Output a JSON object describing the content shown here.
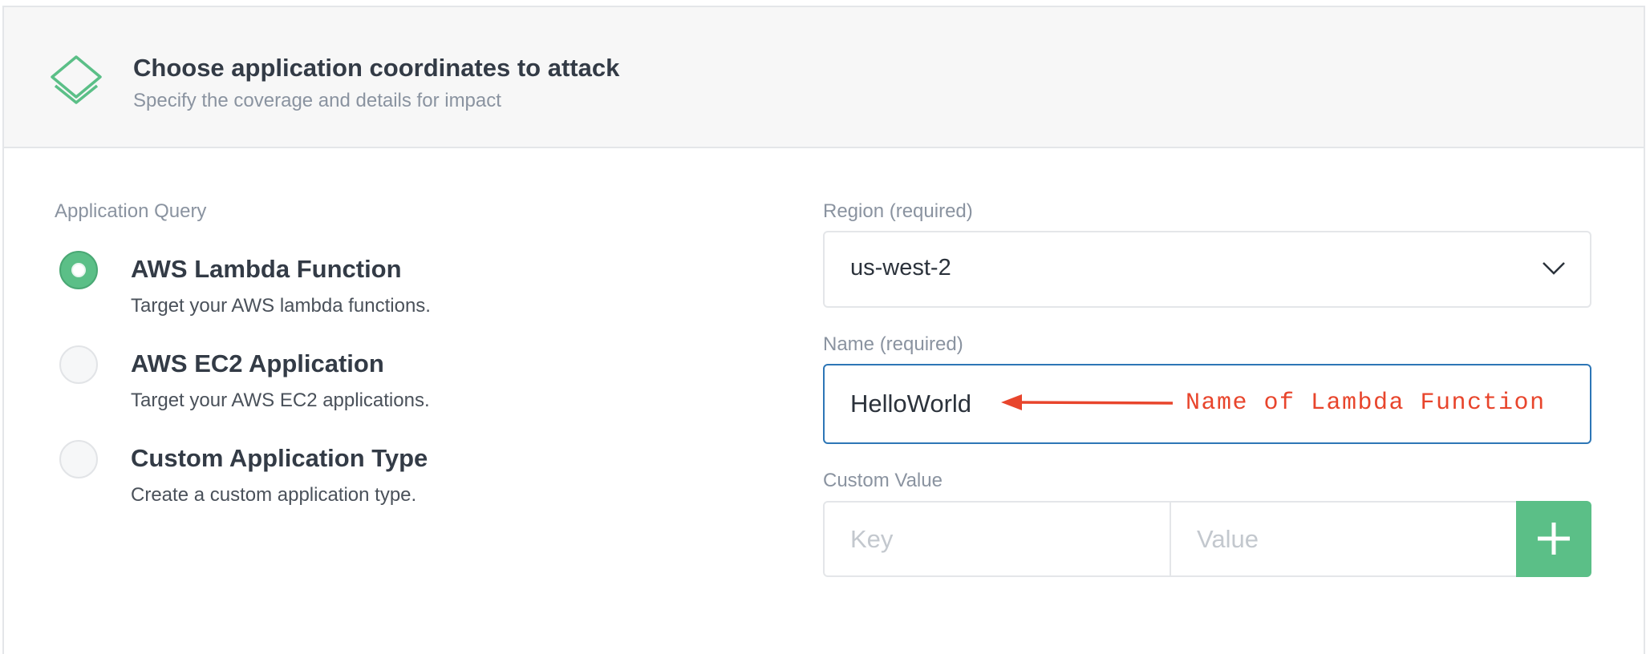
{
  "header": {
    "title": "Choose application coordinates to attack",
    "subtitle": "Specify the coverage and details for impact",
    "icon": "layers-icon",
    "accent_color": "#5bbf87"
  },
  "application_query": {
    "label": "Application Query",
    "options": [
      {
        "title": "AWS Lambda Function",
        "description": "Target your AWS lambda functions.",
        "selected": true
      },
      {
        "title": "AWS EC2 Application",
        "description": "Target your AWS EC2 applications.",
        "selected": false
      },
      {
        "title": "Custom Application Type",
        "description": "Create a custom application type.",
        "selected": false
      }
    ]
  },
  "region": {
    "label": "Region (required)",
    "value": "us-west-2"
  },
  "name": {
    "label": "Name (required)",
    "value": "HelloWorld",
    "annotation": "Name of Lambda Function",
    "annotation_color": "#e8452c"
  },
  "custom_value": {
    "label": "Custom Value",
    "key_placeholder": "Key",
    "value_placeholder": "Value",
    "add_icon": "plus-icon"
  }
}
